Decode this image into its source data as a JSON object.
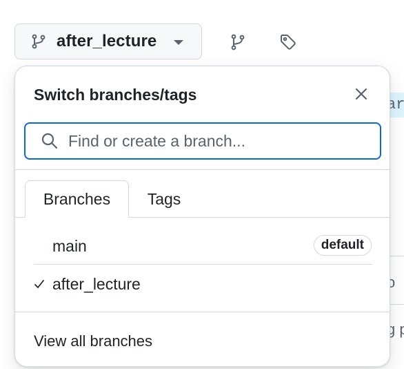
{
  "toolbar": {
    "current_branch": "after_lecture",
    "branch_icon": "git-branch-icon",
    "caret_icon": "triangle-down-icon",
    "branches_icon": "git-branch-icon",
    "tags_icon": "tag-icon"
  },
  "popup": {
    "title": "Switch branches/tags",
    "close_icon": "x-icon",
    "search": {
      "placeholder": "Find or create a branch...",
      "value": "",
      "icon": "search-icon"
    },
    "tabs": [
      {
        "label": "Branches",
        "active": true
      },
      {
        "label": "Tags",
        "active": false
      }
    ],
    "branches": [
      {
        "name": "main",
        "badge": "default",
        "selected": false
      },
      {
        "name": "after_lecture",
        "badge": "",
        "selected": true
      }
    ],
    "footer_link": "View all branches"
  },
  "background": {
    "code_fragment": "ari",
    "text_fragment_1": "o",
    "text_fragment_2": "g p"
  },
  "colors": {
    "accent": "#0969da",
    "border": "#d1d9e0",
    "text": "#1f2328",
    "muted": "#59636e",
    "button_bg": "#f6f8fa"
  }
}
